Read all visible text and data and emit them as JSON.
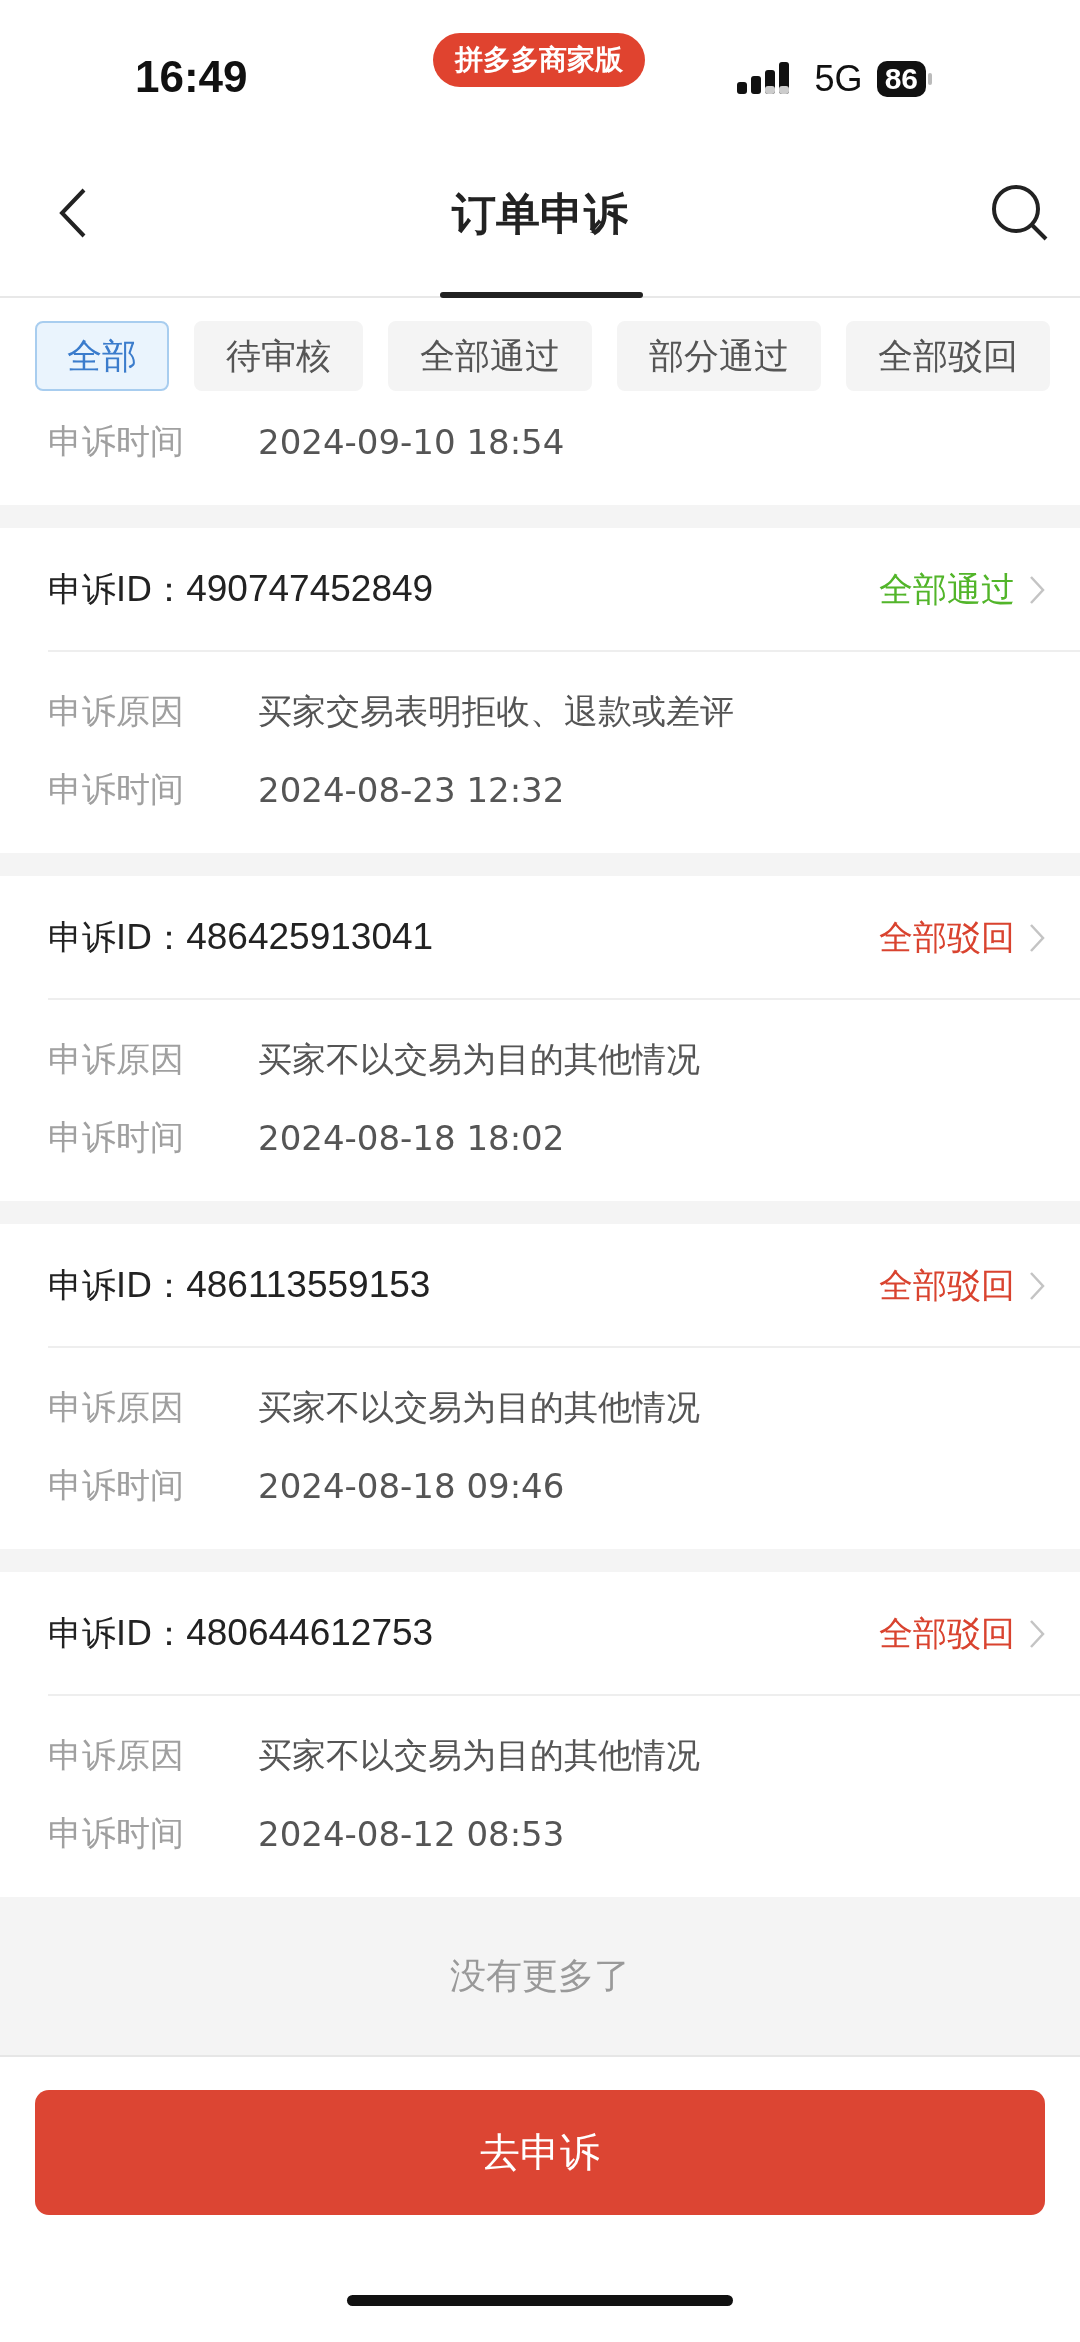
{
  "status_bar": {
    "time": "16:49",
    "app_badge": "拼多多商家版",
    "network": "5G",
    "battery": "86"
  },
  "nav": {
    "title": "订单申诉"
  },
  "filters": [
    {
      "label": "全部",
      "selected": true
    },
    {
      "label": "待审核",
      "selected": false
    },
    {
      "label": "全部通过",
      "selected": false
    },
    {
      "label": "部分通过",
      "selected": false
    },
    {
      "label": "全部驳回",
      "selected": false
    }
  ],
  "partial_appeal": {
    "time_label": "申诉时间",
    "time": "2024-09-10 18:54"
  },
  "appeals": [
    {
      "id_label": "申诉ID：",
      "id": "490747452849",
      "status": "全部通过",
      "color": "#52b52a",
      "reason_label": "申诉原因",
      "reason": "买家交易表明拒收、退款或差评",
      "time_label": "申诉时间",
      "time": "2024-08-23 12:32"
    },
    {
      "id_label": "申诉ID：",
      "id": "486425913041",
      "status": "全部驳回",
      "color": "#d9432f",
      "reason_label": "申诉原因",
      "reason": "买家不以交易为目的其他情况",
      "time_label": "申诉时间",
      "time": "2024-08-18 18:02"
    },
    {
      "id_label": "申诉ID：",
      "id": "486113559153",
      "status": "全部驳回",
      "color": "#d9432f",
      "reason_label": "申诉原因",
      "reason": "买家不以交易为目的其他情况",
      "time_label": "申诉时间",
      "time": "2024-08-18 09:46"
    },
    {
      "id_label": "申诉ID：",
      "id": "480644612753",
      "status": "全部驳回",
      "color": "#d9432f",
      "reason_label": "申诉原因",
      "reason": "买家不以交易为目的其他情况",
      "time_label": "申诉时间",
      "time": "2024-08-12 08:53"
    }
  ],
  "end_text": "没有更多了",
  "action_button": "去申诉"
}
